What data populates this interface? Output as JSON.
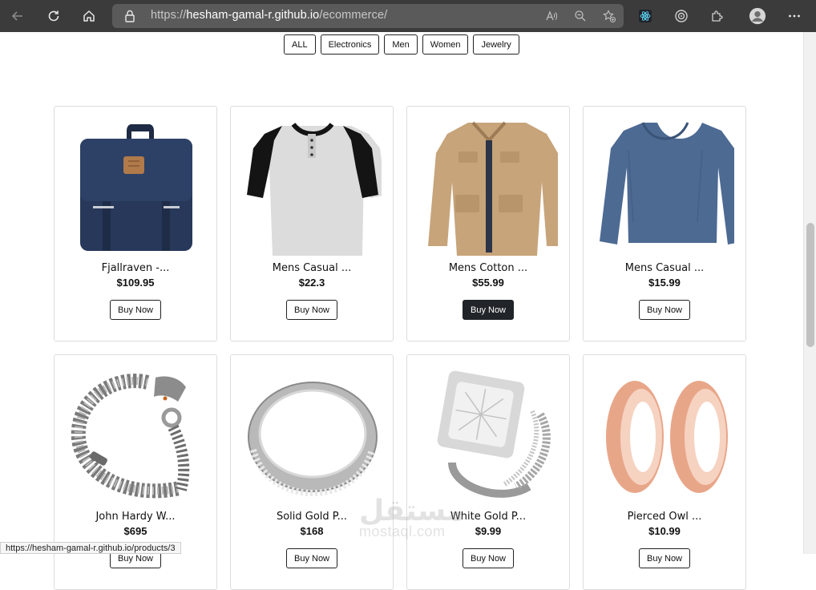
{
  "browser": {
    "url_prefix": "https://",
    "url_host": "hesham-gamal-r.github.io",
    "url_path": "/ecommerce/"
  },
  "filters": [
    "ALL",
    "Electronics",
    "Men",
    "Women",
    "Jewelry"
  ],
  "products": [
    {
      "title": "Fjallraven -...",
      "price": "$109.95",
      "buy_label": "Buy Now",
      "icon": "backpack-image"
    },
    {
      "title": "Mens Casual ...",
      "price": "$22.3",
      "buy_label": "Buy Now",
      "icon": "tshirt-image"
    },
    {
      "title": "Mens Cotton ...",
      "price": "$55.99",
      "buy_label": "Buy Now",
      "icon": "jacket-image"
    },
    {
      "title": "Mens Casual ...",
      "price": "$15.99",
      "buy_label": "Buy Now",
      "icon": "longsleeve-image"
    },
    {
      "title": "John Hardy W...",
      "price": "$695",
      "buy_label": "Buy Now",
      "icon": "bracelet-image"
    },
    {
      "title": "Solid Gold P...",
      "price": "$168",
      "buy_label": "Buy Now",
      "icon": "ring-image"
    },
    {
      "title": "White Gold P...",
      "price": "$9.99",
      "buy_label": "Buy Now",
      "icon": "diamond-ring-image"
    },
    {
      "title": "Pierced Owl ...",
      "price": "$10.99",
      "buy_label": "Buy Now",
      "icon": "earrings-image"
    }
  ],
  "status_url": "https://hesham-gamal-r.github.io/products/3",
  "watermark": {
    "arabic": "مستقل",
    "latin": "mostaql.com"
  },
  "colors": {
    "chrome_bg": "#3b3b3b",
    "address_bg": "#5a5a5a",
    "dark_button": "#212529"
  }
}
